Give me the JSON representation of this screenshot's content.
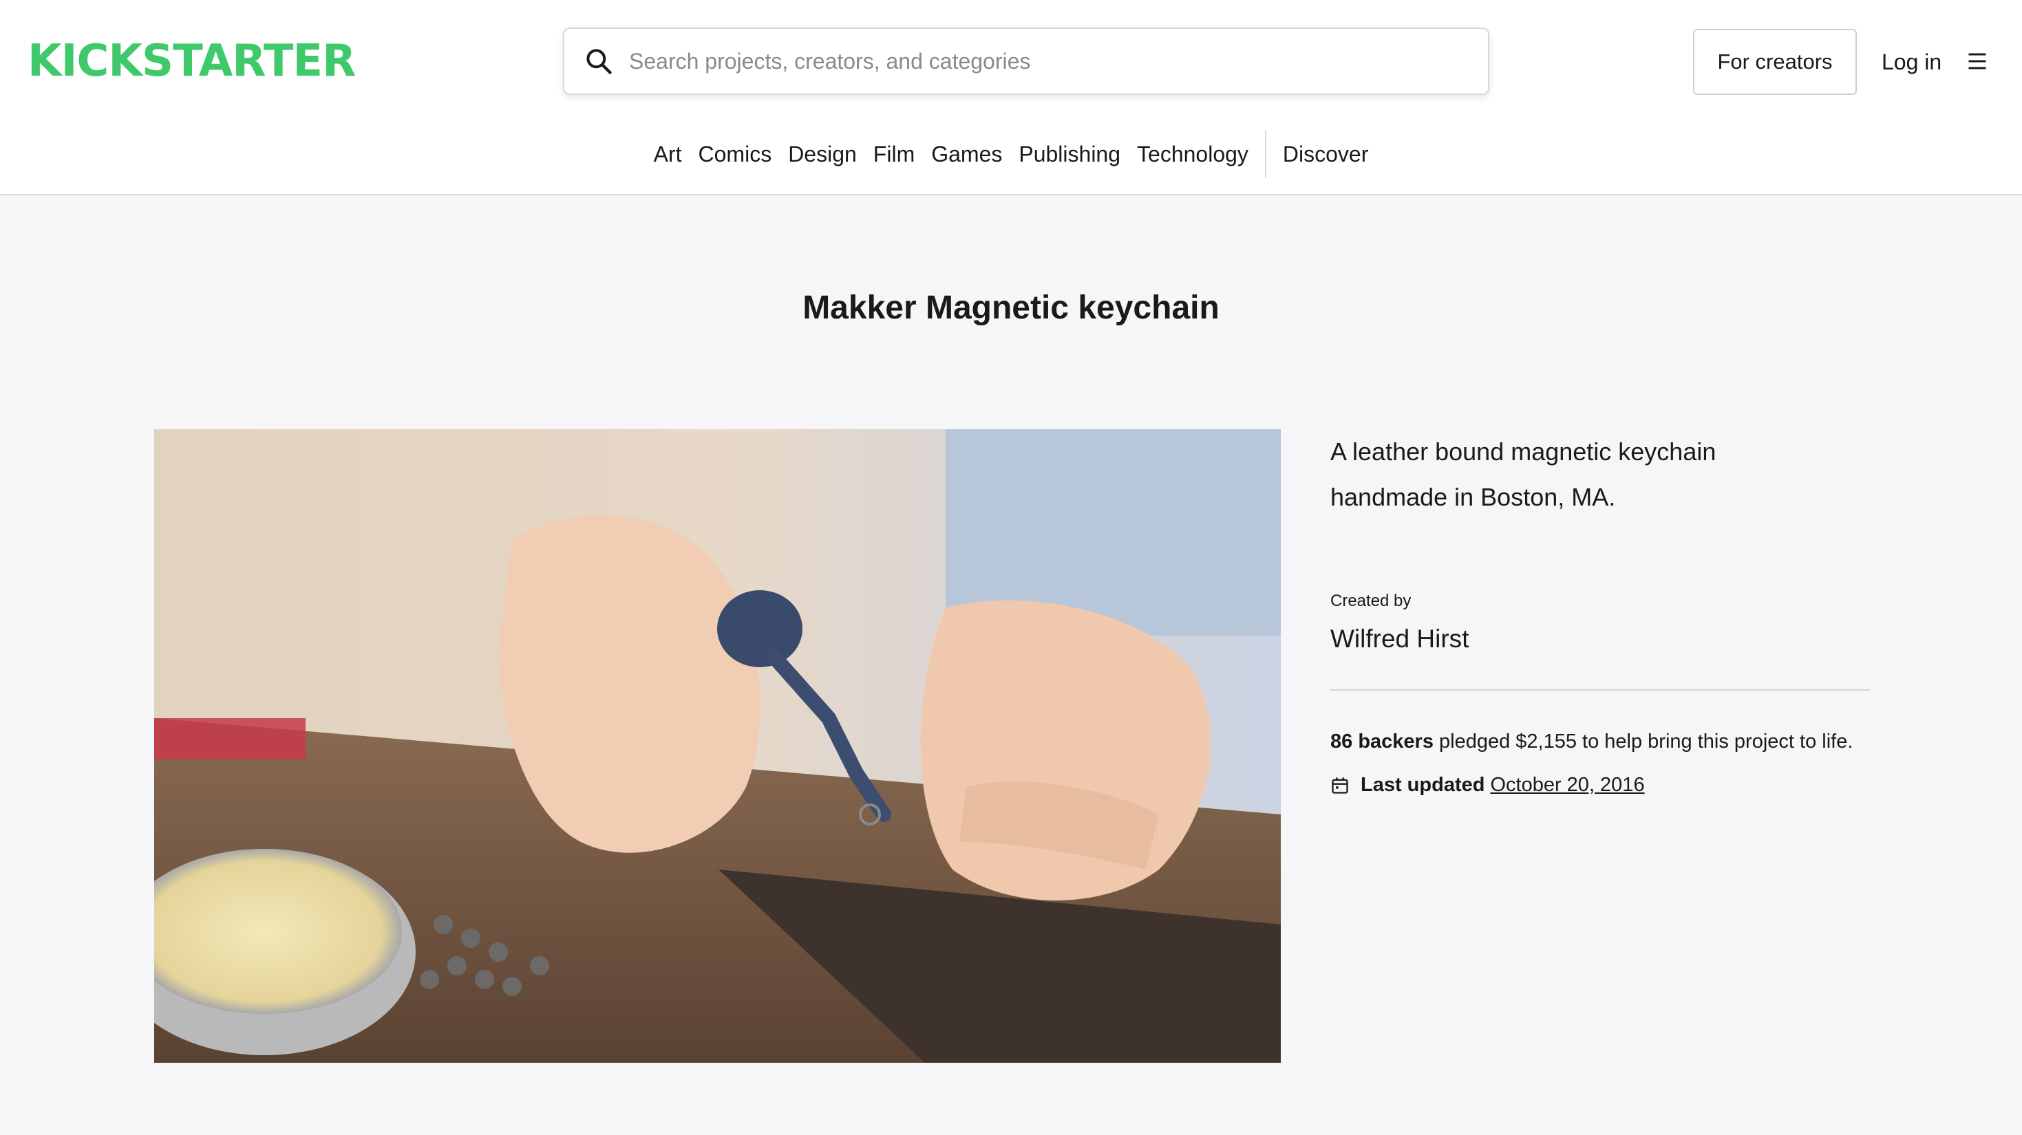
{
  "header": {
    "logo_text": "KICKSTARTER",
    "search_placeholder": "Search projects, creators, and categories",
    "for_creators_label": "For creators",
    "login_label": "Log in",
    "brand_color": "#3fc96a"
  },
  "nav": {
    "categories": [
      "Art",
      "Comics",
      "Design",
      "Film",
      "Games",
      "Publishing",
      "Technology"
    ],
    "discover_label": "Discover"
  },
  "project": {
    "title": "Makker Magnetic keychain",
    "blurb": "A leather bound magnetic keychain handmade in Boston, MA.",
    "created_by_label": "Created by",
    "creator_name": "Wilfred Hirst",
    "backers_count": "86 backers",
    "pledged_text": " pledged $2,155 to help bring this project to life.",
    "last_updated_label": "Last updated",
    "last_updated_date": "October 20, 2016"
  },
  "icons": {
    "search": "search-icon",
    "menu": "menu-icon",
    "calendar": "calendar-icon"
  }
}
